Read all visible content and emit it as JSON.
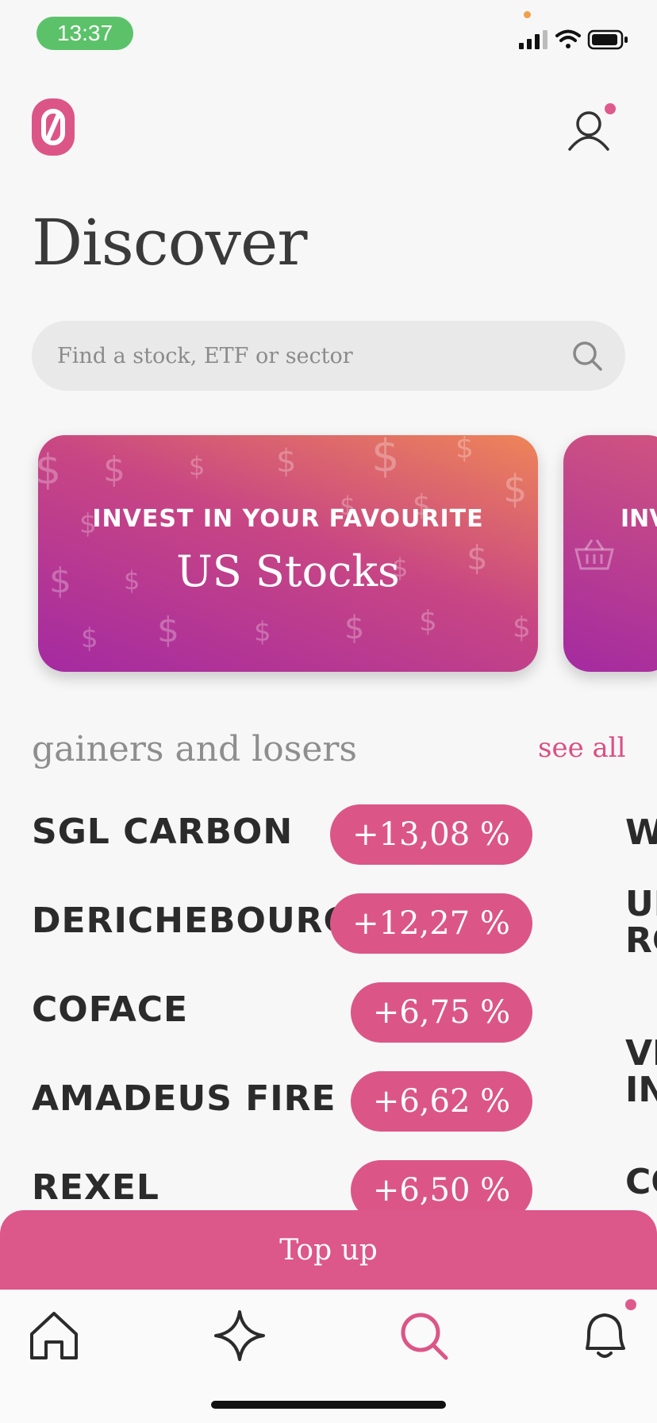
{
  "status_bar": {
    "time": "13:37"
  },
  "page": {
    "title": "Discover"
  },
  "search": {
    "placeholder": "Find a stock, ETF or sector"
  },
  "cards": [
    {
      "eyebrow": "INVEST IN YOUR FAVOURITE",
      "title": "US Stocks"
    },
    {
      "eyebrow": "INV"
    }
  ],
  "movers": {
    "title": "gainers and losers",
    "see_all": "see all",
    "gainers": [
      {
        "name": "SGL CARBON",
        "change": "+13,08 %"
      },
      {
        "name": "DERICHEBOURG",
        "change": "+12,27 %"
      },
      {
        "name": "COFACE",
        "change": "+6,75 %"
      },
      {
        "name": "AMADEUS FIRE",
        "change": "+6,62 %"
      },
      {
        "name": "REXEL",
        "change": "+6,50 %"
      }
    ],
    "second_column": [
      {
        "line1": "W",
        "line2": ""
      },
      {
        "line1": "UI",
        "line2": "RO"
      },
      {
        "line1": "VI",
        "line2": "IN"
      },
      {
        "line1": "CO",
        "line2": ""
      }
    ]
  },
  "actions": {
    "top_up": "Top up"
  },
  "tabbar": {
    "items": [
      {
        "icon": "home-icon"
      },
      {
        "icon": "sparkle-icon"
      },
      {
        "icon": "search-icon",
        "active": true
      },
      {
        "icon": "bell-icon"
      }
    ]
  },
  "colors": {
    "accent": "#db5686",
    "status_green": "#5cc26a",
    "title_text": "#3a3a3a"
  }
}
